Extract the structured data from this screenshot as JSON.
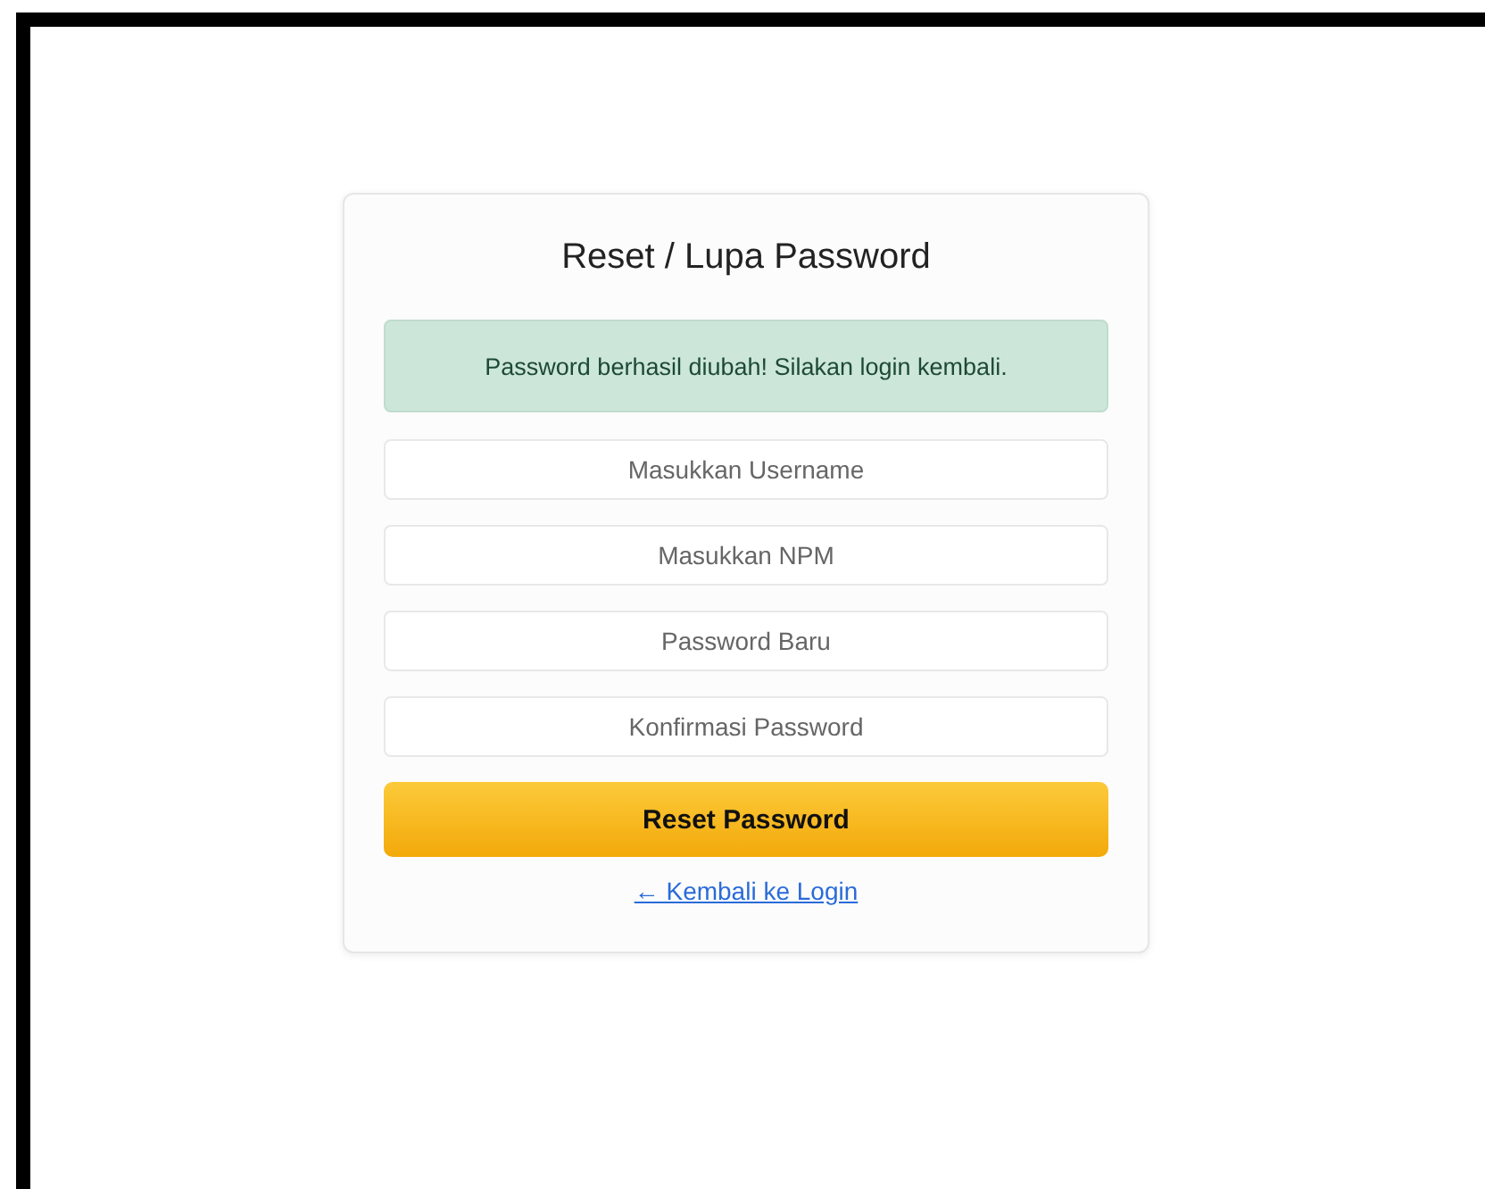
{
  "card": {
    "title": "Reset / Lupa Password",
    "alert": {
      "kind": "success",
      "text": "Password berhasil diubah! Silakan login kembali."
    },
    "fields": [
      {
        "placeholder": "Masukkan Username"
      },
      {
        "placeholder": "Masukkan NPM"
      },
      {
        "placeholder": "Password Baru"
      },
      {
        "placeholder": "Konfirmasi Password"
      }
    ],
    "submit_button": "Reset Password",
    "back_link": "← Kembali ke Login"
  }
}
